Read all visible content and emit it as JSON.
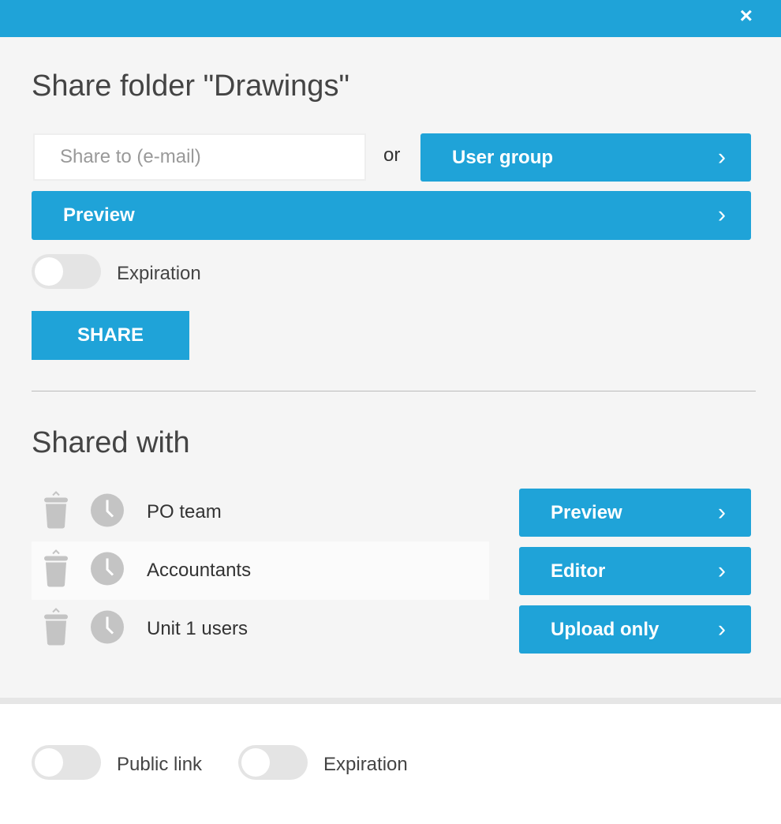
{
  "header": {
    "close_icon": "close-icon",
    "close_label": "×"
  },
  "title": "Share folder \"Drawings\"",
  "email": {
    "placeholder": "Share to (e-mail)",
    "value": ""
  },
  "or_label": "or",
  "user_group_label": "User group",
  "permission_label": "Preview",
  "chevron": "›",
  "expiration": {
    "label": "Expiration",
    "on": false
  },
  "share_label": "SHARE",
  "shared_with": {
    "title": "Shared with",
    "items": [
      {
        "name": "PO team",
        "permission": "Preview"
      },
      {
        "name": "Accountants",
        "permission": "Editor"
      },
      {
        "name": "Unit 1 users",
        "permission": "Upload only"
      }
    ]
  },
  "footer": {
    "public_link": {
      "label": "Public link",
      "on": false
    },
    "expiration": {
      "label": "Expiration",
      "on": false
    }
  },
  "colors": {
    "accent": "#1fa3d8",
    "icon_gray": "#c4c4c4"
  }
}
